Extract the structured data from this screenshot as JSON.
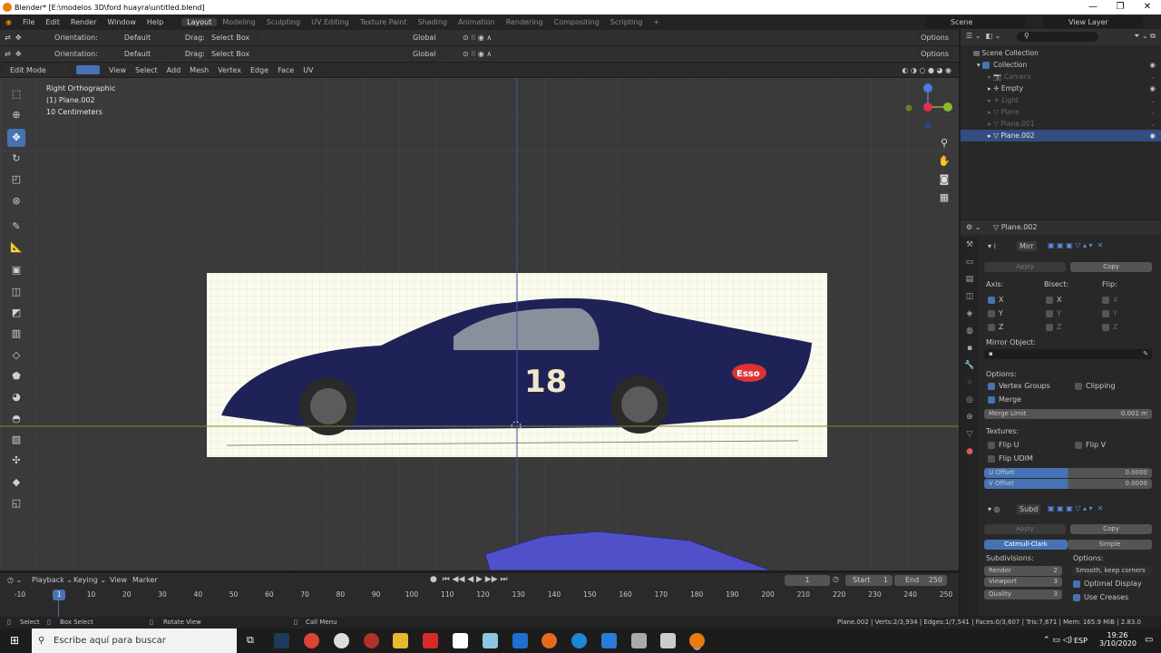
{
  "window": {
    "title": "Blender* [E:\\modelos 3D\\ford huayra\\untitled.blend]"
  },
  "menu": {
    "items": [
      "File",
      "Edit",
      "Render",
      "Window",
      "Help"
    ]
  },
  "workspaces": [
    "Layout",
    "Modeling",
    "Sculpting",
    "UV Editing",
    "Texture Paint",
    "Shading",
    "Animation",
    "Rendering",
    "Compositing",
    "Scripting"
  ],
  "scene": {
    "label": "Scene",
    "view_layer": "View Layer"
  },
  "tool_header": {
    "orientation_label": "Orientation:",
    "orientation_value": "Default",
    "drag_label": "Drag:",
    "drag_value": "Select Box",
    "transform_orientation": "Global",
    "options": "Options"
  },
  "mode_header": {
    "mode": "Edit Mode",
    "menus": [
      "View",
      "Select",
      "Add",
      "Mesh",
      "Vertex",
      "Edge",
      "Face",
      "UV"
    ]
  },
  "viewport": {
    "view_name": "Right Orthographic",
    "object_name": "(1) Plane.002",
    "scale": "10 Centimeters",
    "reference_numbers": "18",
    "sponsor": "Esso"
  },
  "outliner": {
    "root": "Scene Collection",
    "collection": "Collection",
    "items": [
      "Camera",
      "Empty",
      "Light",
      "Plane",
      "Plane.001",
      "Plane.002"
    ],
    "selected": "Plane.002"
  },
  "properties": {
    "object": "Plane.002",
    "mirror": {
      "name": "Mirr",
      "apply": "Apply",
      "copy": "Copy",
      "axis_label": "Axis:",
      "bisect_label": "Bisect:",
      "flip_label": "Flip:",
      "axes": [
        "X",
        "Y",
        "Z"
      ],
      "mirror_object_label": "Mirror Object:",
      "options_label": "Options:",
      "vertex_groups": "Vertex Groups",
      "clipping": "Clipping",
      "merge": "Merge",
      "merge_limit_label": "Merge Limit",
      "merge_limit_value": "0.001 m",
      "textures_label": "Textures:",
      "flip_u": "Flip U",
      "flip_v": "Flip V",
      "flip_udim": "Flip UDIM",
      "u_offset_label": "U Offset",
      "u_offset_value": "0.0000",
      "v_offset_label": "V Offset",
      "v_offset_value": "0.0000"
    },
    "subdivision": {
      "name": "Subd",
      "apply": "Apply",
      "copy": "Copy",
      "catmull": "Catmull-Clark",
      "simple": "Simple",
      "subdivisions_label": "Subdivisions:",
      "options_label": "Options:",
      "render_label": "Render",
      "render_value": "2",
      "viewport_label": "Viewport",
      "viewport_value": "3",
      "quality_label": "Quality",
      "quality_value": "3",
      "uv_smooth": "Smooth, keep corners",
      "optimal_display": "Optimal Display",
      "use_creases": "Use Creases"
    }
  },
  "timeline": {
    "menus": [
      "Playback",
      "Keying",
      "View",
      "Marker"
    ],
    "current_frame": "1",
    "start_label": "Start",
    "start_value": "1",
    "end_label": "End",
    "end_value": "250",
    "ticks": [
      "-10",
      "1",
      "10",
      "20",
      "30",
      "40",
      "50",
      "60",
      "70",
      "80",
      "90",
      "100",
      "110",
      "120",
      "130",
      "140",
      "150",
      "160",
      "170",
      "180",
      "190",
      "200",
      "210",
      "220",
      "230",
      "240",
      "250"
    ]
  },
  "status": {
    "select": "Select",
    "box_select": "Box Select",
    "rotate_view": "Rotate View",
    "call_menu": "Call Menu",
    "stats": "Plane.002 | Verts:2/3,934 | Edges:1/7,541 | Faces:0/3,607 | Tris:7,671 | Mem: 165.9 MiB | 2.83.0"
  },
  "taskbar": {
    "search_placeholder": "Escribe aquí para buscar",
    "lang": "ESP",
    "time": "19:26",
    "date": "3/10/2020"
  },
  "colors": {
    "accent": "#4772b3",
    "viewport_bg": "#3a3a3a",
    "panel_bg": "#282828"
  }
}
